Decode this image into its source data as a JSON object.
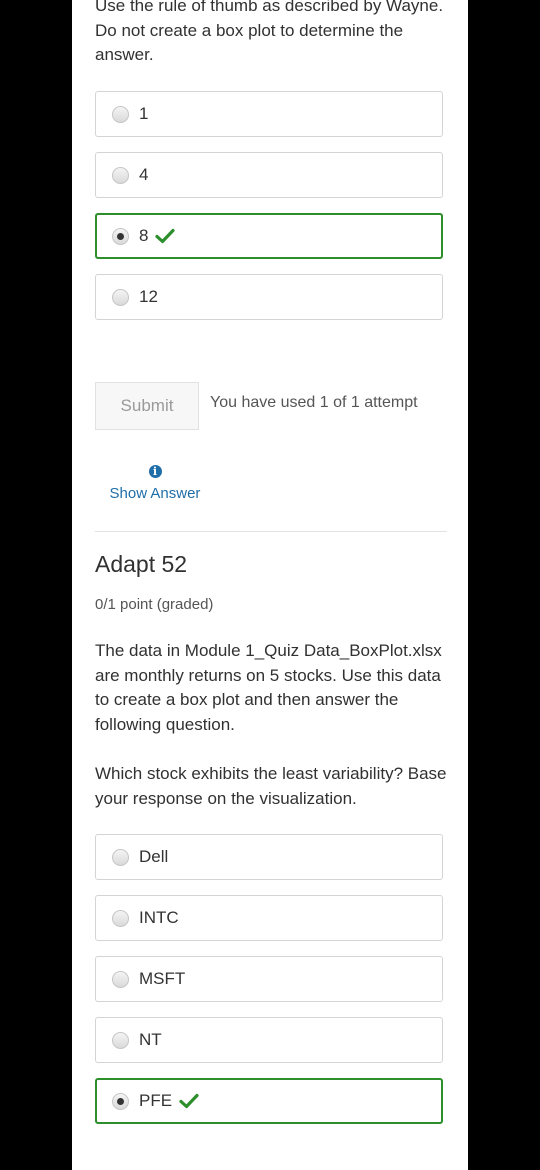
{
  "q1": {
    "text": "Use the rule of thumb as described by Wayne. Do not create a box plot to determine the answer.",
    "options": [
      {
        "label": "1",
        "selected": false,
        "correct": false
      },
      {
        "label": "4",
        "selected": false,
        "correct": false
      },
      {
        "label": "8",
        "selected": true,
        "correct": true
      },
      {
        "label": "12",
        "selected": false,
        "correct": false
      }
    ],
    "submit_label": "Submit",
    "attempts_text": "You have used 1 of 1 attempt",
    "show_answer_label": "Show Answer"
  },
  "q2": {
    "title": "Adapt 52",
    "points": "0/1 point (graded)",
    "text1": "The data in Module 1_Quiz Data_BoxPlot.xlsx are monthly returns on 5 stocks. Use this data to create a box plot and then answer the following question.",
    "text2": "Which stock exhibits the least variability? Base your response on the visualization.",
    "options": [
      {
        "label": "Dell",
        "selected": false,
        "correct": false
      },
      {
        "label": "INTC",
        "selected": false,
        "correct": false
      },
      {
        "label": "MSFT",
        "selected": false,
        "correct": false
      },
      {
        "label": "NT",
        "selected": false,
        "correct": false
      },
      {
        "label": "PFE",
        "selected": true,
        "correct": true
      }
    ]
  },
  "colors": {
    "correct": "#2c8f2c",
    "link": "#1f6ea8"
  },
  "icons": {
    "correct": "checkmark-icon",
    "info": "info-icon"
  }
}
